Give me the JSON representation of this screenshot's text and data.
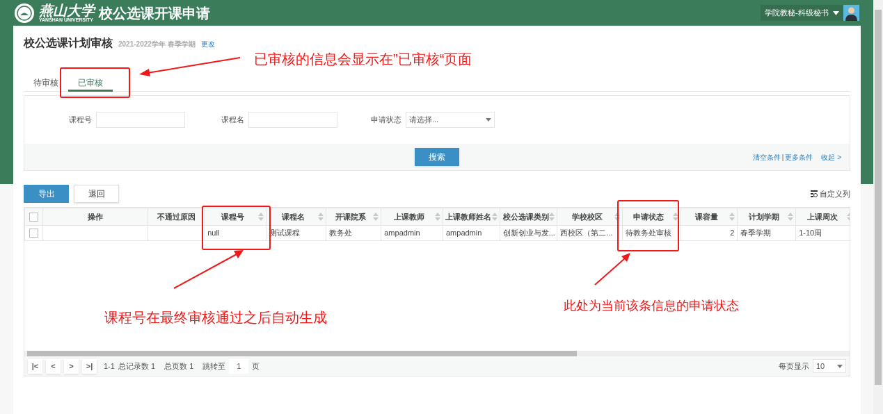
{
  "header": {
    "logo_text": "燕山大学",
    "logo_subtext": "YANSHAN UNIVERSITY",
    "title": "校公选课开课申请",
    "user": "学院教秘-科级秘书"
  },
  "page": {
    "title": "校公选课计划审核",
    "term": "2021-2022学年 春季学期",
    "change_link": "更改"
  },
  "tabs": [
    {
      "label": "待审核",
      "selected": false
    },
    {
      "label": "已审核",
      "selected": true
    }
  ],
  "filters": [
    {
      "kind": "text",
      "label": "课程号"
    },
    {
      "kind": "text",
      "label": "课程名"
    },
    {
      "kind": "select",
      "label": "申请状态",
      "placeholder": "请选择..."
    }
  ],
  "search_button": "搜索",
  "filter_links": [
    "清空条件",
    "|",
    "更多条件",
    "收起 >"
  ],
  "actions": [
    "导出",
    "退回"
  ],
  "customize_columns": "自定义列",
  "table": {
    "select_all_checked": false,
    "columns": [
      {
        "label": "操作",
        "sortable": false
      },
      {
        "label": "不通过原因",
        "sortable": false
      },
      {
        "label": "课程号",
        "sortable": true
      },
      {
        "label": "课程名",
        "sortable": true
      },
      {
        "label": "开课院系",
        "sortable": true
      },
      {
        "label": "上课教师",
        "sortable": true
      },
      {
        "label": "上课教师姓名",
        "sortable": true
      },
      {
        "label": "校公选课类别",
        "sortable": true
      },
      {
        "label": "学校校区",
        "sortable": true
      },
      {
        "label": "申请状态",
        "sortable": true
      },
      {
        "label": "课容量",
        "sortable": true
      },
      {
        "label": "计划学期",
        "sortable": true
      },
      {
        "label": "上课周次",
        "sortable": true
      }
    ],
    "rows": [
      {
        "checked": false,
        "cells": [
          "",
          "",
          "null",
          "测试课程",
          "教务处",
          "ampadmin",
          "ampadmin",
          "创新创业与发...",
          "西校区（第二...",
          "待教务处审核",
          "2",
          "春季学期",
          "1-10周"
        ]
      }
    ]
  },
  "pagination": {
    "buttons": [
      "|<",
      "<",
      ">",
      ">|"
    ],
    "range": "1-1",
    "total_label": "总记录数 1",
    "pages_label": "总页数 1",
    "jump_label": "跳转至",
    "jump_value": "1",
    "page_unit": "页",
    "per_page_label": "每页显示",
    "per_page": "10"
  },
  "annotations": [
    "已审核的信息会显示在”已审核“页面",
    "课程号在最终审核通过之后自动生成",
    "此处为当前该条信息的申请状态"
  ]
}
